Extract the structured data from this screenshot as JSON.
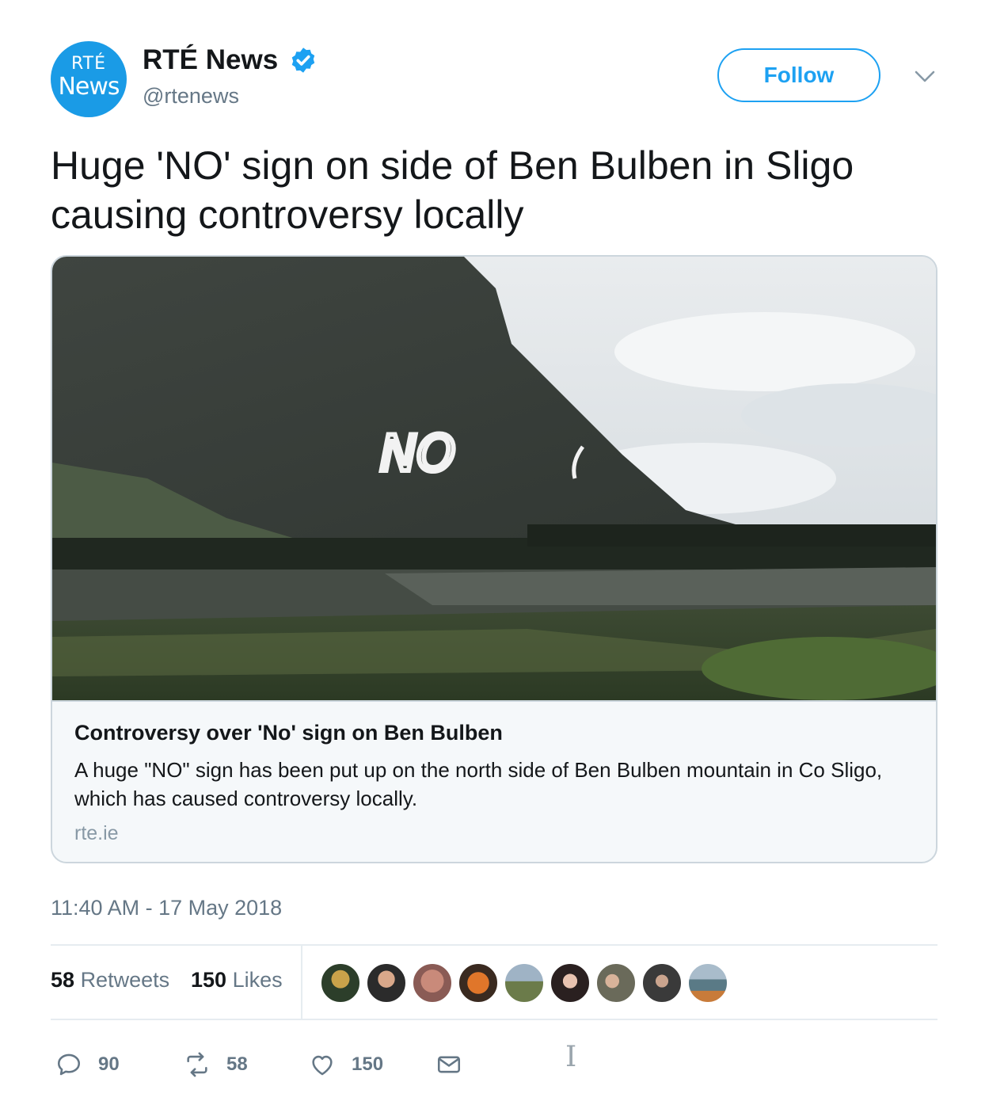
{
  "account": {
    "avatar_line1": "RTÉ",
    "avatar_line2": "News",
    "display_name": "RTÉ News",
    "handle": "@rtenews",
    "verified": true,
    "follow_label": "Follow"
  },
  "tweet": {
    "text": "Huge 'NO' sign on side of Ben Bulben in Sligo causing controversy locally",
    "timestamp": "11:40 AM - 17 May 2018"
  },
  "card": {
    "image_sign_text": "NO",
    "title": "Controversy over 'No' sign on Ben Bulben",
    "description": "A huge \"NO\" sign has been put up on the north side of Ben Bulben mountain in Co Sligo, which has caused controversy locally.",
    "domain": "rte.ie"
  },
  "stats": {
    "retweets_count": "58",
    "retweets_label": "Retweets",
    "likes_count": "150",
    "likes_label": "Likes"
  },
  "actions": {
    "reply_count": "90",
    "retweet_count": "58",
    "like_count": "150"
  },
  "colors": {
    "brand_blue": "#1da1f2",
    "avatar_blue": "#1a9be6",
    "muted_text": "#657786"
  },
  "icons": [
    "verified-badge-icon",
    "chevron-down-icon",
    "reply-icon",
    "retweet-icon",
    "heart-icon",
    "envelope-icon"
  ]
}
